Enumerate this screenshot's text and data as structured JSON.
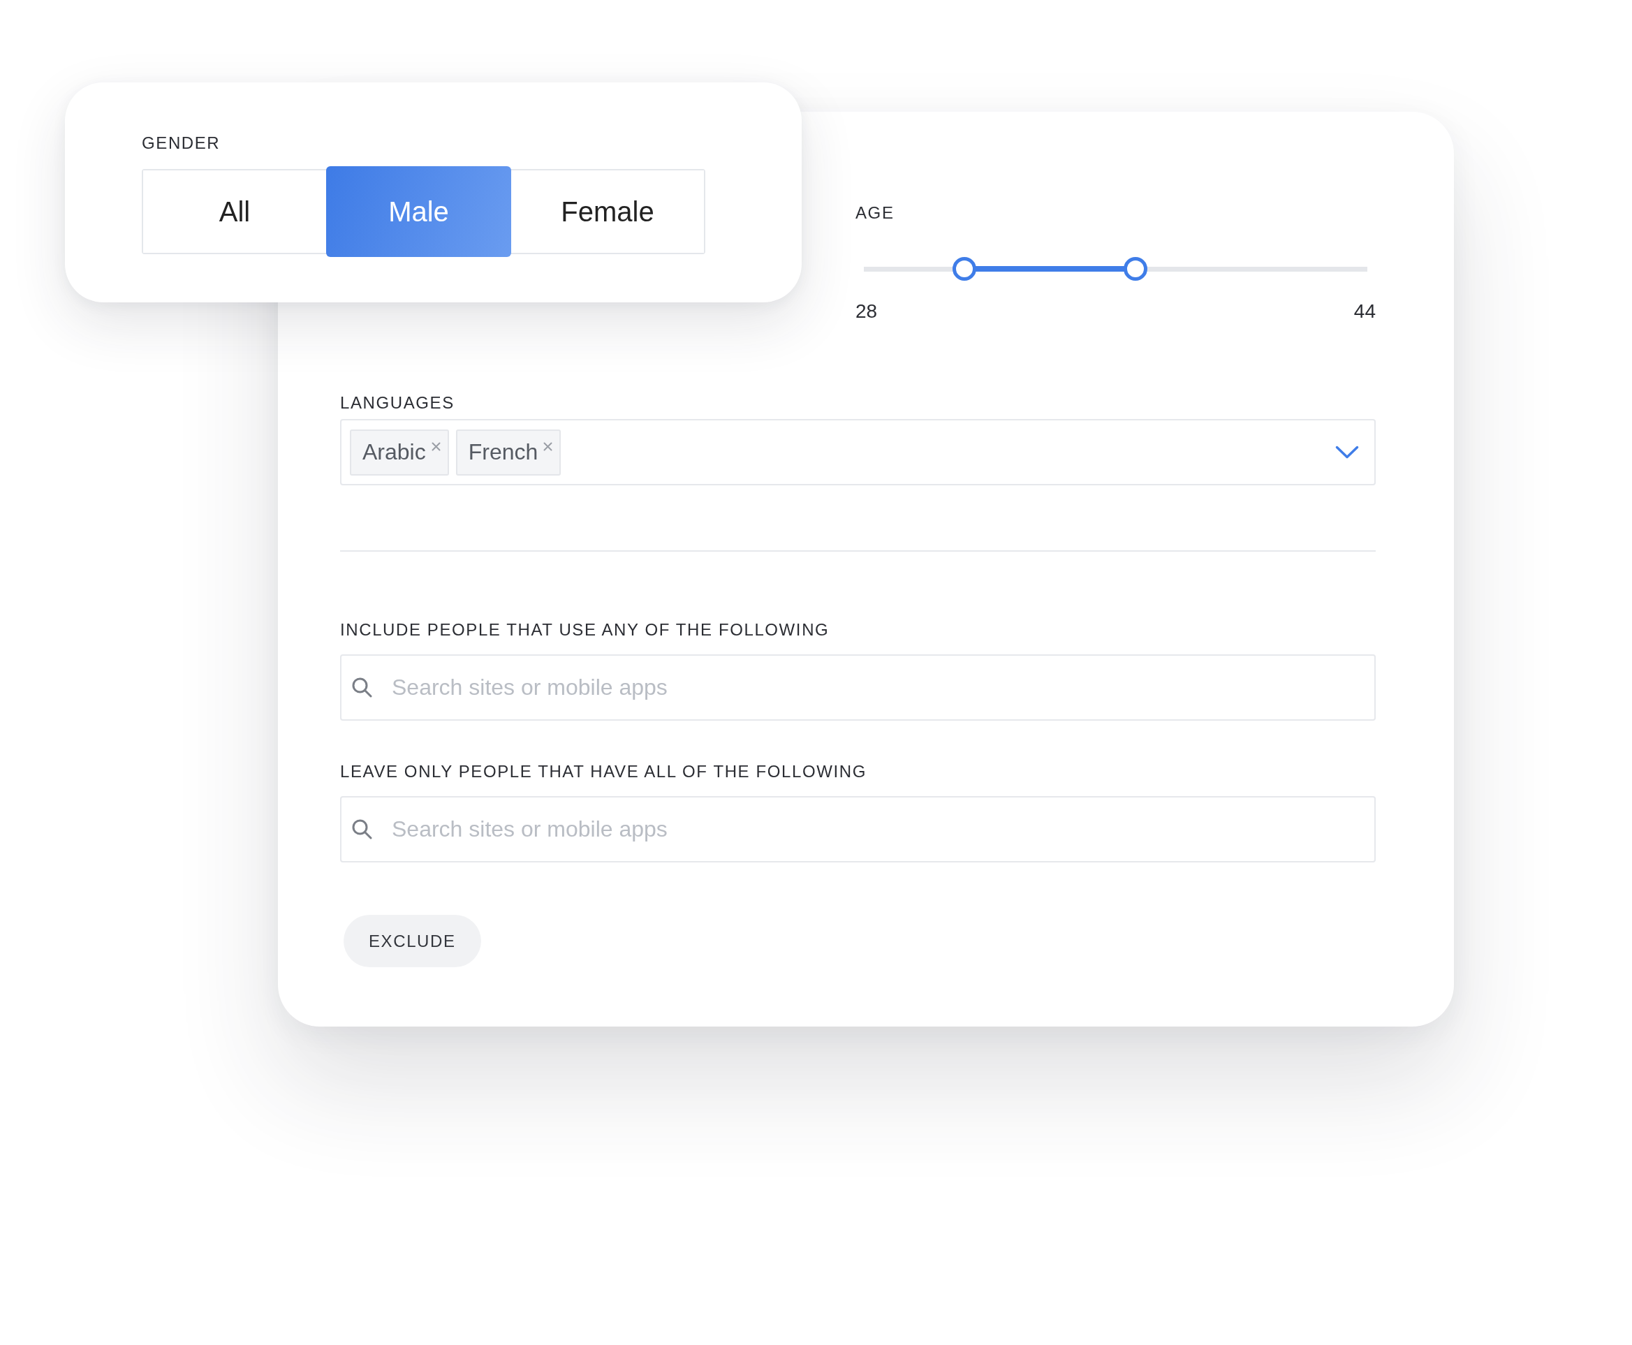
{
  "gender": {
    "label": "GENDER",
    "options": [
      {
        "label": "All",
        "selected": false
      },
      {
        "label": "Male",
        "selected": true
      },
      {
        "label": "Female",
        "selected": false
      }
    ]
  },
  "age": {
    "label": "AGE",
    "thumbs": [
      {
        "level": 0.2
      },
      {
        "level": 0.54
      }
    ],
    "min_label": "28",
    "max_label": "44"
  },
  "languages": {
    "label": "LANGUAGES",
    "tags": [
      "Arabic",
      "French"
    ]
  },
  "site_filters": [
    {
      "label": "INCLUDE PEOPLE THAT USE ANY OF THE FOLLOWING",
      "placeholder": "Search sites or mobile apps"
    },
    {
      "label": "LEAVE ONLY PEOPLE THAT HAVE ALL OF THE FOLLOWING",
      "placeholder": "Search sites or mobile apps"
    }
  ],
  "exclude_button": "EXCLUDE"
}
